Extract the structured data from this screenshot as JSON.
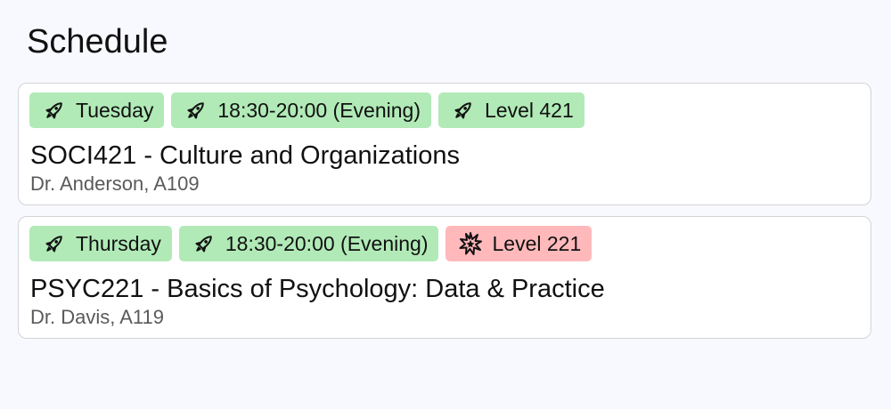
{
  "page": {
    "title": "Schedule"
  },
  "colors": {
    "ok_badge": "#b1eab7",
    "warn_badge": "#ffb9bb",
    "page_bg": "#f8f9fe"
  },
  "courses": [
    {
      "title": "SOCI421 - Culture and Organizations",
      "meta": "Dr. Anderson, A109",
      "badges": [
        {
          "text": "Tuesday",
          "icon": "rocket-icon",
          "status": "ok"
        },
        {
          "text": "18:30-20:00 (Evening)",
          "icon": "rocket-icon",
          "status": "ok"
        },
        {
          "text": "Level 421",
          "icon": "rocket-icon",
          "status": "ok"
        }
      ]
    },
    {
      "title": "PSYC221 - Basics of Psychology: Data & Practice",
      "meta": "Dr. Davis, A119",
      "badges": [
        {
          "text": "Thursday",
          "icon": "rocket-icon",
          "status": "ok"
        },
        {
          "text": "18:30-20:00 (Evening)",
          "icon": "rocket-icon",
          "status": "ok"
        },
        {
          "text": "Level 221",
          "icon": "explosion-icon",
          "status": "warn"
        }
      ]
    }
  ]
}
